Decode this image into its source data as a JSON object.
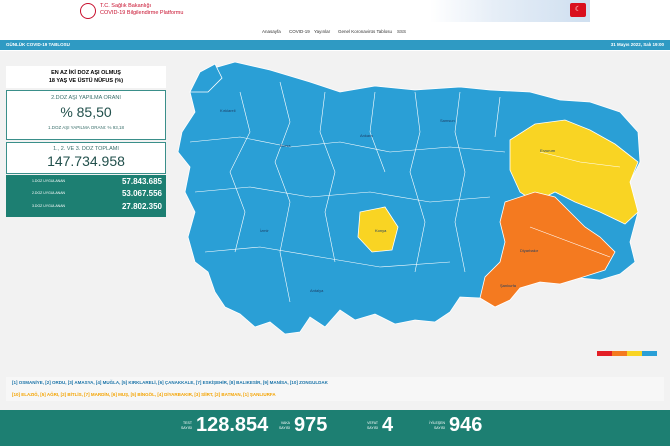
{
  "header": {
    "ministry": "T.C. Sağlık Bakanlığı",
    "platform": "COVID-19 Bilgilendirme Platformu"
  },
  "nav": {
    "items": [
      "Anasayfa",
      "COVID-19",
      "Yayınlar",
      "Genel Koronavirüs Tablosu",
      "SSS"
    ]
  },
  "titlebar": {
    "title": "GÜNLÜK COVID-19 TABLOSU",
    "date": "31 Mayıs 2022, Salı 19:00"
  },
  "panel": {
    "title_line1": "EN AZ İKİ DOZ AŞI OLMUŞ",
    "title_line2": "18 YAŞ VE ÜSTÜ NÜFUS (%)",
    "second_dose_label": "2.DOZ AŞI YAPILMA ORANI",
    "second_dose_value": "% 85,50",
    "first_dose_note": "1.DOZ AŞI YAPILMA ORANI: % 93,18",
    "total_label": "1., 2. VE 3. DOZ TOPLAMI",
    "total_value": "147.734.958",
    "doses": [
      {
        "label": "1.DOZ UYGULANAN",
        "value": "57.843.685"
      },
      {
        "label": "2.DOZ UYGULANAN",
        "value": "53.067.556"
      },
      {
        "label": "3.DOZ UYGULANAN",
        "value": "27.802.350"
      }
    ]
  },
  "legend_colors": {
    "red": "#e31f26",
    "orange": "#f47a20",
    "yellow": "#f9d423",
    "blue": "#2a9fd6"
  },
  "notes": {
    "row1": "[1] OSMANİYE, [2] ORDU, [3] AMASYA, [4] MUĞLA, [5] KIRKLARELİ, [6] ÇANAKKALE, [7] ESKİŞEHİR, [8] BALIKESİR, [9] MANİSA, [10] ZONGULDAK",
    "row2": "[10] ELAZIĞ, [5] AĞRI, [2] BİTLİS, [7] MARDİN, [6] MUŞ, [5] BİNGÖL, [4] DİYARBAKIR, [3] SİİRT, [2] BATMAN, [1] ŞANLIURFA"
  },
  "stats": [
    {
      "label_line1": "TEST",
      "label_line2": "SAYISI",
      "value": "128.854"
    },
    {
      "label_line1": "VAKA",
      "label_line2": "SAYISI",
      "value": "975"
    },
    {
      "label_line1": "VEFAT",
      "label_line2": "SAYISI",
      "value": "4"
    },
    {
      "label_line1": "İYİLEŞEN",
      "label_line2": "SAYISI",
      "value": "946"
    }
  ]
}
